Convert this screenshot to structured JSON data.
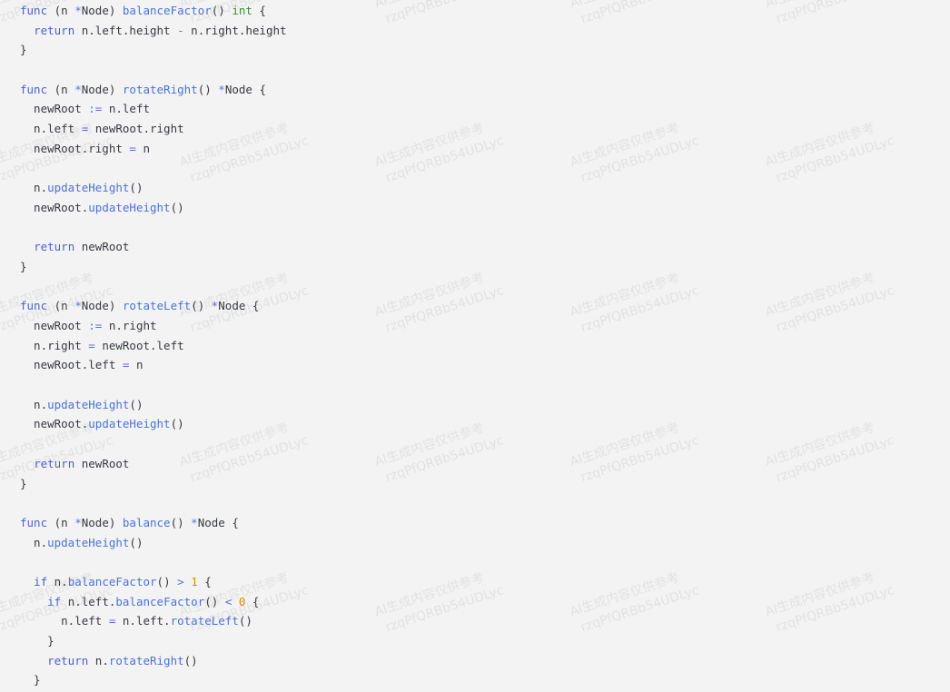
{
  "watermark": {
    "line1": "AI生成内容仅供参考",
    "line2": "rzqPfQRBb54UDLyc"
  },
  "code": {
    "lines": [
      [
        {
          "t": "kw",
          "v": "func"
        },
        {
          "t": "plain",
          "v": " (n "
        },
        {
          "t": "op",
          "v": "*"
        },
        {
          "t": "plain",
          "v": "Node) "
        },
        {
          "t": "fn",
          "v": "balanceFactor"
        },
        {
          "t": "plain",
          "v": "() "
        },
        {
          "t": "type",
          "v": "int"
        },
        {
          "t": "plain",
          "v": " {"
        }
      ],
      [
        {
          "t": "plain",
          "v": "  "
        },
        {
          "t": "kw",
          "v": "return"
        },
        {
          "t": "plain",
          "v": " n.left.height "
        },
        {
          "t": "op",
          "v": "-"
        },
        {
          "t": "plain",
          "v": " n.right.height"
        }
      ],
      [
        {
          "t": "plain",
          "v": "}"
        }
      ],
      [],
      [
        {
          "t": "kw",
          "v": "func"
        },
        {
          "t": "plain",
          "v": " (n "
        },
        {
          "t": "op",
          "v": "*"
        },
        {
          "t": "plain",
          "v": "Node) "
        },
        {
          "t": "fn",
          "v": "rotateRight"
        },
        {
          "t": "plain",
          "v": "() "
        },
        {
          "t": "op",
          "v": "*"
        },
        {
          "t": "plain",
          "v": "Node {"
        }
      ],
      [
        {
          "t": "plain",
          "v": "  newRoot "
        },
        {
          "t": "op",
          "v": ":="
        },
        {
          "t": "plain",
          "v": " n.left"
        }
      ],
      [
        {
          "t": "plain",
          "v": "  n.left "
        },
        {
          "t": "op",
          "v": "="
        },
        {
          "t": "plain",
          "v": " newRoot.right"
        }
      ],
      [
        {
          "t": "plain",
          "v": "  newRoot.right "
        },
        {
          "t": "op",
          "v": "="
        },
        {
          "t": "plain",
          "v": " n"
        }
      ],
      [],
      [
        {
          "t": "plain",
          "v": "  n."
        },
        {
          "t": "fn",
          "v": "updateHeight"
        },
        {
          "t": "plain",
          "v": "()"
        }
      ],
      [
        {
          "t": "plain",
          "v": "  newRoot."
        },
        {
          "t": "fn",
          "v": "updateHeight"
        },
        {
          "t": "plain",
          "v": "()"
        }
      ],
      [],
      [
        {
          "t": "plain",
          "v": "  "
        },
        {
          "t": "kw",
          "v": "return"
        },
        {
          "t": "plain",
          "v": " newRoot"
        }
      ],
      [
        {
          "t": "plain",
          "v": "}"
        }
      ],
      [],
      [
        {
          "t": "kw",
          "v": "func"
        },
        {
          "t": "plain",
          "v": " (n "
        },
        {
          "t": "op",
          "v": "*"
        },
        {
          "t": "plain",
          "v": "Node) "
        },
        {
          "t": "fn",
          "v": "rotateLeft"
        },
        {
          "t": "plain",
          "v": "() "
        },
        {
          "t": "op",
          "v": "*"
        },
        {
          "t": "plain",
          "v": "Node {"
        }
      ],
      [
        {
          "t": "plain",
          "v": "  newRoot "
        },
        {
          "t": "op",
          "v": ":="
        },
        {
          "t": "plain",
          "v": " n.right"
        }
      ],
      [
        {
          "t": "plain",
          "v": "  n.right "
        },
        {
          "t": "op",
          "v": "="
        },
        {
          "t": "plain",
          "v": " newRoot.left"
        }
      ],
      [
        {
          "t": "plain",
          "v": "  newRoot.left "
        },
        {
          "t": "op",
          "v": "="
        },
        {
          "t": "plain",
          "v": " n"
        }
      ],
      [],
      [
        {
          "t": "plain",
          "v": "  n."
        },
        {
          "t": "fn",
          "v": "updateHeight"
        },
        {
          "t": "plain",
          "v": "()"
        }
      ],
      [
        {
          "t": "plain",
          "v": "  newRoot."
        },
        {
          "t": "fn",
          "v": "updateHeight"
        },
        {
          "t": "plain",
          "v": "()"
        }
      ],
      [],
      [
        {
          "t": "plain",
          "v": "  "
        },
        {
          "t": "kw",
          "v": "return"
        },
        {
          "t": "plain",
          "v": " newRoot"
        }
      ],
      [
        {
          "t": "plain",
          "v": "}"
        }
      ],
      [],
      [
        {
          "t": "kw",
          "v": "func"
        },
        {
          "t": "plain",
          "v": " (n "
        },
        {
          "t": "op",
          "v": "*"
        },
        {
          "t": "plain",
          "v": "Node) "
        },
        {
          "t": "fn",
          "v": "balance"
        },
        {
          "t": "plain",
          "v": "() "
        },
        {
          "t": "op",
          "v": "*"
        },
        {
          "t": "plain",
          "v": "Node {"
        }
      ],
      [
        {
          "t": "plain",
          "v": "  n."
        },
        {
          "t": "fn",
          "v": "updateHeight"
        },
        {
          "t": "plain",
          "v": "()"
        }
      ],
      [],
      [
        {
          "t": "plain",
          "v": "  "
        },
        {
          "t": "kw",
          "v": "if"
        },
        {
          "t": "plain",
          "v": " n."
        },
        {
          "t": "fn",
          "v": "balanceFactor"
        },
        {
          "t": "plain",
          "v": "() "
        },
        {
          "t": "op",
          "v": ">"
        },
        {
          "t": "plain",
          "v": " "
        },
        {
          "t": "num",
          "v": "1"
        },
        {
          "t": "plain",
          "v": " {"
        }
      ],
      [
        {
          "t": "plain",
          "v": "    "
        },
        {
          "t": "kw",
          "v": "if"
        },
        {
          "t": "plain",
          "v": " n.left."
        },
        {
          "t": "fn",
          "v": "balanceFactor"
        },
        {
          "t": "plain",
          "v": "() "
        },
        {
          "t": "op",
          "v": "<"
        },
        {
          "t": "plain",
          "v": " "
        },
        {
          "t": "num",
          "v": "0"
        },
        {
          "t": "plain",
          "v": " {"
        }
      ],
      [
        {
          "t": "plain",
          "v": "      n.left "
        },
        {
          "t": "op",
          "v": "="
        },
        {
          "t": "plain",
          "v": " n.left."
        },
        {
          "t": "fn",
          "v": "rotateLeft"
        },
        {
          "t": "plain",
          "v": "()"
        }
      ],
      [
        {
          "t": "plain",
          "v": "    }"
        }
      ],
      [
        {
          "t": "plain",
          "v": "    "
        },
        {
          "t": "kw",
          "v": "return"
        },
        {
          "t": "plain",
          "v": " n."
        },
        {
          "t": "fn",
          "v": "rotateRight"
        },
        {
          "t": "plain",
          "v": "()"
        }
      ],
      [
        {
          "t": "plain",
          "v": "  }"
        }
      ]
    ]
  }
}
